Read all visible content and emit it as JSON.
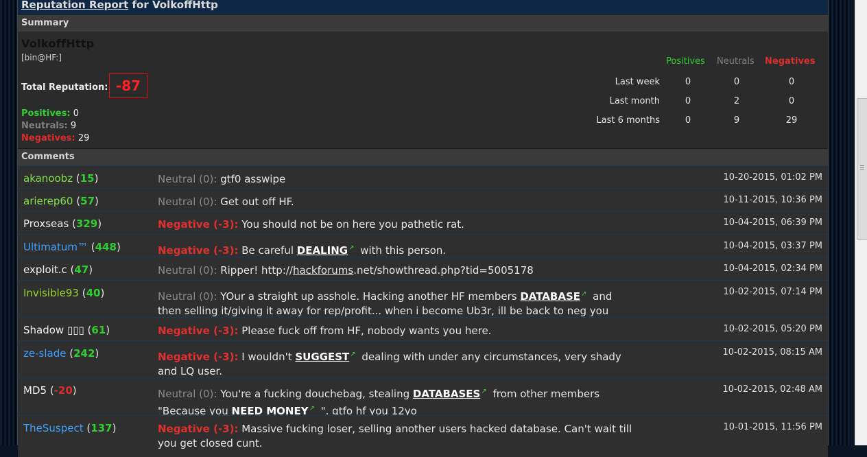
{
  "title": {
    "link": "Reputation Report",
    "rest": " for VolkoffHttp"
  },
  "summary": {
    "heading": "Summary",
    "username": "VolkoffHttp",
    "usertitle": "[bin@HF:]",
    "total_label": "Total Reputation:",
    "total_value": "-87",
    "positives_label": "Positives:",
    "positives_value": "0",
    "neutrals_label": "Neutrals:",
    "neutrals_value": "9",
    "negatives_label": "Negatives:",
    "negatives_value": "29",
    "stats": {
      "headers": [
        "Positives",
        "Neutrals",
        "Negatives"
      ],
      "rows": [
        {
          "label": "Last week",
          "values": [
            "0",
            "0",
            "0"
          ]
        },
        {
          "label": "Last month",
          "values": [
            "0",
            "2",
            "0"
          ]
        },
        {
          "label": "Last 6 months",
          "values": [
            "0",
            "9",
            "29"
          ]
        }
      ]
    }
  },
  "comments": {
    "heading": "Comments",
    "items": [
      {
        "user": "akanoobz",
        "rep": "15",
        "tag": "Neutral (0):",
        "text": "gtf0 asswipe",
        "date": "10-20-2015, 01:02 PM"
      },
      {
        "user": "arierep60",
        "rep": "57",
        "tag": "Neutral (0):",
        "text": "Get out off HF.",
        "date": "10-11-2015, 10:36 PM"
      },
      {
        "user": "Proxseas",
        "rep": "329",
        "tag": "Negative (-3):",
        "text": "You should not be on here you pathetic rat.",
        "date": "10-04-2015, 06:39 PM"
      },
      {
        "user": "Ultimatum™",
        "rep": "448",
        "tag": "Negative (-3):",
        "text_a": "Be careful ",
        "kw": "DEALING",
        "text_b": " with this person.",
        "date": "10-04-2015, 03:37 PM"
      },
      {
        "user": "exploit.c",
        "rep": "47",
        "tag": "Neutral (0):",
        "text_a": "Ripper! http://",
        "link": "hackforums",
        "text_b": ".net/showthread.php?tid=5005178",
        "date": "10-04-2015, 02:34 PM"
      },
      {
        "user": "Invisible93",
        "rep": "40",
        "tag": "Neutral (0):",
        "text_a": "YOur a straight up asshole. Hacking another HF members ",
        "kw": "DATABASE",
        "text_b": " and then selling it/giving it away for rep/profit... when i become Ub3r, ill be back to neg you",
        "date": "10-02-2015, 07:14 PM"
      },
      {
        "user": "Shadow ▯▯▯",
        "rep": "61",
        "tag": "Negative (-3):",
        "text": "Please fuck off from HF, nobody wants you here.",
        "date": "10-02-2015, 05:20 PM"
      },
      {
        "user": "ze-slade",
        "rep": "242",
        "tag": "Negative (-3):",
        "text_a": "I wouldn't ",
        "kw": "SUGGEST",
        "text_b": " dealing with under any circumstances, very shady and LQ user.",
        "date": "10-02-2015, 08:15 AM"
      },
      {
        "user": "MD5",
        "rep": "-20",
        "tag": "Neutral (0):",
        "text_a": "You're a fucking douchebag, stealing ",
        "kw": "DATABASES",
        "text_b": " from other members \"Because you ",
        "kw2": "NEED MONEY",
        "text_c": " \". gtfo hf you 12yo",
        "date": "10-02-2015, 02:48 AM"
      },
      {
        "user": "TheSuspect",
        "rep": "137",
        "tag": "Negative (-3):",
        "text": "Massive fucking loser, selling another users hacked database. Can't wait till you get closed cunt.",
        "date": "10-01-2015, 11:56 PM"
      }
    ]
  },
  "ext_icon": "external-link-icon",
  "colors": {
    "positive": "#2fcf2f",
    "neutral": "#808080",
    "negative": "#dd2c2c",
    "header": "#0d2744"
  }
}
